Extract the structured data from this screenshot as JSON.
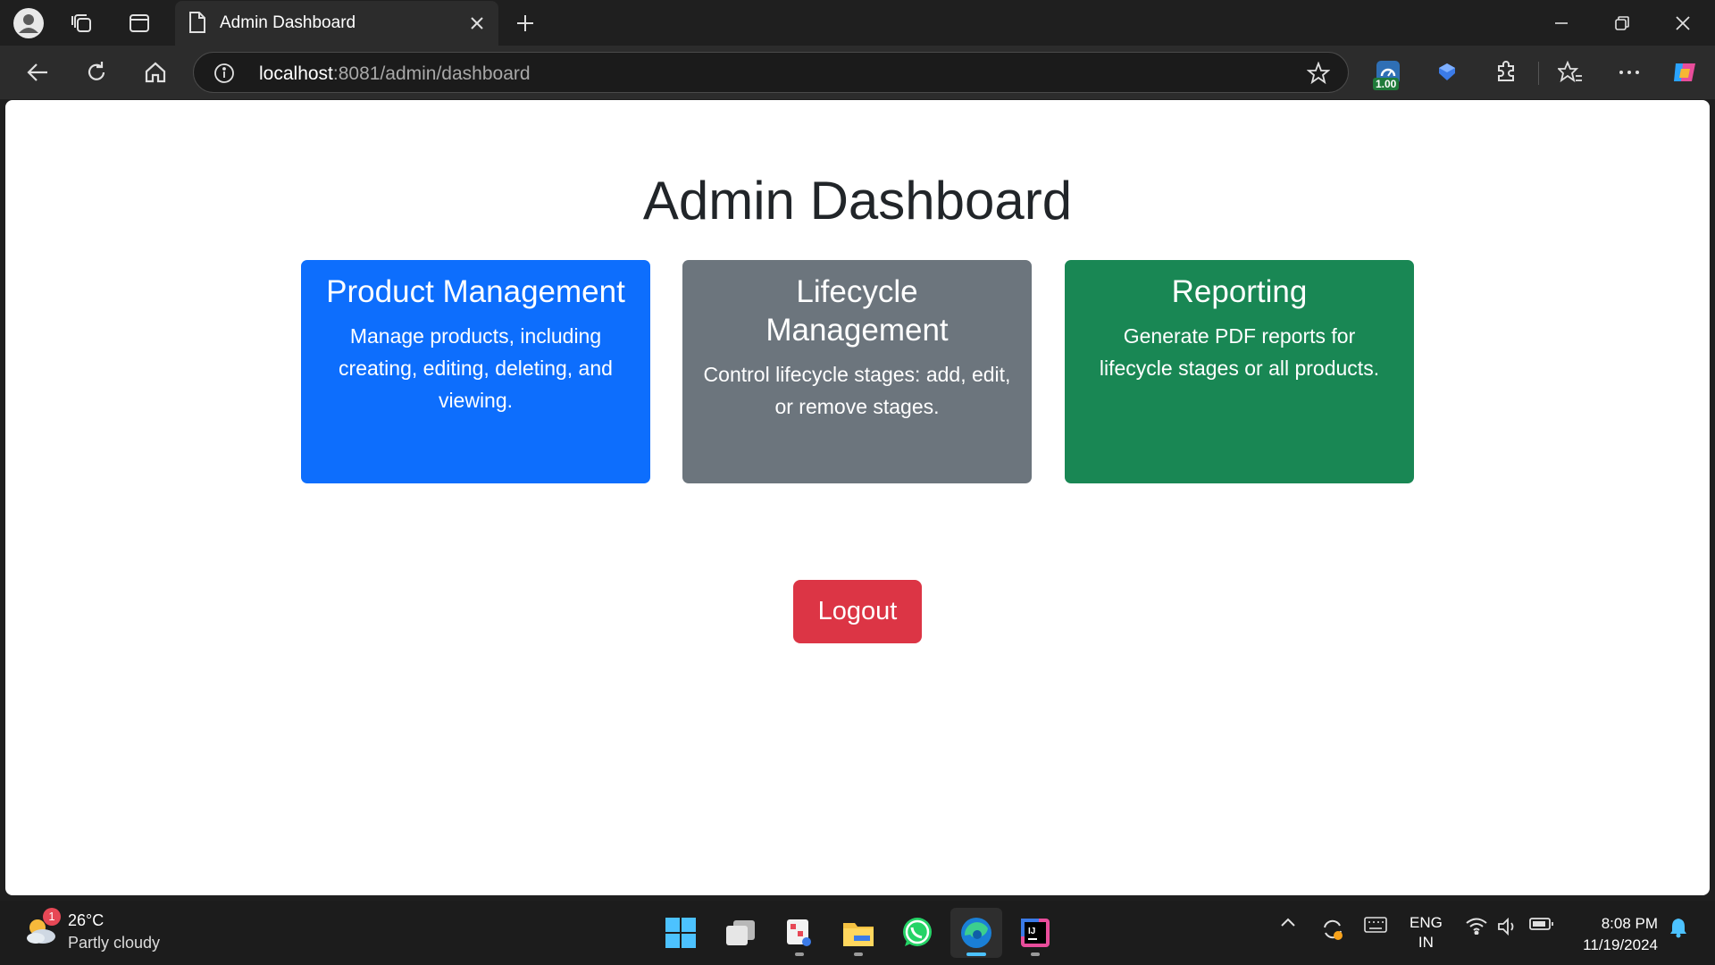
{
  "browser": {
    "tab_title": "Admin Dashboard",
    "url_host": "localhost",
    "url_rest": ":8081/admin/dashboard",
    "extension_badge": "1.00"
  },
  "page": {
    "title": "Admin Dashboard",
    "cards": [
      {
        "title": "Product Management",
        "text": "Manage products, including creating, editing, deleting, and viewing.",
        "color": "#0d6efd"
      },
      {
        "title": "Lifecycle Management",
        "text": "Control lifecycle stages: add, edit, or remove stages.",
        "color": "#6c757d"
      },
      {
        "title": "Reporting",
        "text": "Generate PDF reports for lifecycle stages or all products.",
        "color": "#198754"
      }
    ],
    "logout_label": "Logout",
    "logout_color": "#dc3545"
  },
  "taskbar": {
    "weather_badge": "1",
    "weather_temp": "26°C",
    "weather_desc": "Partly cloudy",
    "apps": [
      "start-icon",
      "task-view-icon",
      "snipping-tool-icon",
      "file-explorer-icon",
      "whatsapp-icon",
      "edge-icon",
      "intellij-icon"
    ],
    "lang_line1": "ENG",
    "lang_line2": "IN",
    "time": "8:08 PM",
    "date": "11/19/2024"
  }
}
